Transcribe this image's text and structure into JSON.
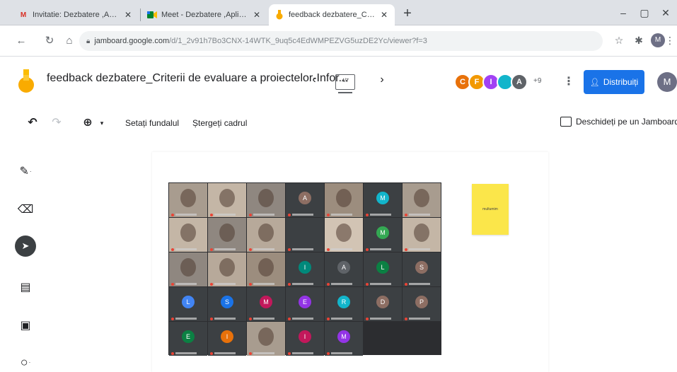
{
  "browser": {
    "tabs": [
      {
        "label": "Invitatie: Dezbatere ,Aplicarea c",
        "favicon": "M",
        "favicon_color": "#d93025",
        "active": false
      },
      {
        "label": "Meet - Dezbatere ,Aplicarea cri",
        "favicon": "meet-icon",
        "favicon_color": "#00832d",
        "active": false
      },
      {
        "label": "feedback dezbatere_Criterii de",
        "favicon": "jamboard-icon",
        "favicon_color": "#f9ab00",
        "active": true
      }
    ],
    "new_tab": "+",
    "url_host": "jamboard.google.com",
    "url_path": "/d/1_2v91h7Bo3CNX-14WTK_9uq5c4EdWMPEZVG5uzDE2Yc/viewer?f=3",
    "window_controls": [
      "–",
      "▢",
      "✕"
    ]
  },
  "board": {
    "title": "feedback dezbatere_Criterii de evaluare a proiectelor-Infor...",
    "frame_indicator": "4/7",
    "prev": "‹",
    "next": "›",
    "collaborators": [
      {
        "initial": "C",
        "color": "#e8710a"
      },
      {
        "initial": "F",
        "color": "#f29900"
      },
      {
        "initial": "I",
        "color": "#a142f4"
      },
      {
        "initial": "",
        "color": "#12b5cb"
      },
      {
        "initial": "A",
        "color": "#5f6368"
      }
    ],
    "collaborators_more": "+9",
    "share_label": "Distribuiți",
    "profile_initial": "M"
  },
  "toolbar": {
    "undo": "↶",
    "redo": "↷",
    "zoom": "⊕",
    "zoom_caret": "▾",
    "set_background": "Setați fundalul",
    "clear_frame": "Ștergeți cadrul",
    "open_in_jamboard": "Deschideți pe un Jamboard"
  },
  "tools": [
    {
      "name": "pen-tool",
      "glyph": "✎",
      "has_menu": true,
      "selected": false
    },
    {
      "name": "eraser-tool",
      "glyph": "⌫",
      "has_menu": false,
      "selected": false
    },
    {
      "name": "select-tool",
      "glyph": "➤",
      "has_menu": false,
      "selected": true
    },
    {
      "name": "sticky-note-tool",
      "glyph": "▤",
      "has_menu": false,
      "selected": false
    },
    {
      "name": "image-tool",
      "glyph": "▣",
      "has_menu": false,
      "selected": false
    },
    {
      "name": "shape-tool",
      "glyph": "○",
      "has_menu": true,
      "selected": false
    }
  ],
  "meet_tiles": [
    {
      "initial": "",
      "color": "",
      "photo": true
    },
    {
      "initial": "",
      "color": "",
      "photo": true
    },
    {
      "initial": "",
      "color": "",
      "photo": true
    },
    {
      "initial": "A",
      "color": "#8d6e63",
      "photo": false
    },
    {
      "initial": "",
      "color": "",
      "photo": true
    },
    {
      "initial": "M",
      "color": "#12b5cb",
      "photo": false
    },
    {
      "initial": "",
      "color": "",
      "photo": true
    },
    {
      "initial": "",
      "color": "",
      "photo": true
    },
    {
      "initial": "",
      "color": "",
      "photo": true
    },
    {
      "initial": "",
      "color": "",
      "photo": true
    },
    {
      "initial": "",
      "color": "",
      "photo": false
    },
    {
      "initial": "",
      "color": "",
      "photo": true
    },
    {
      "initial": "M",
      "color": "#34a853",
      "photo": false
    },
    {
      "initial": "",
      "color": "",
      "photo": true
    },
    {
      "initial": "",
      "color": "",
      "photo": true
    },
    {
      "initial": "",
      "color": "",
      "photo": true
    },
    {
      "initial": "",
      "color": "",
      "photo": true
    },
    {
      "initial": "I",
      "color": "#00897b",
      "photo": false
    },
    {
      "initial": "A",
      "color": "#5f6368",
      "photo": false
    },
    {
      "initial": "L",
      "color": "#0b8043",
      "photo": false
    },
    {
      "initial": "S",
      "color": "#8d6e63",
      "photo": false
    },
    {
      "initial": "L",
      "color": "#4285f4",
      "photo": false
    },
    {
      "initial": "S",
      "color": "#1a73e8",
      "photo": false
    },
    {
      "initial": "M",
      "color": "#c2185b",
      "photo": false
    },
    {
      "initial": "E",
      "color": "#9334e6",
      "photo": false
    },
    {
      "initial": "R",
      "color": "#12b5cb",
      "photo": false
    },
    {
      "initial": "D",
      "color": "#8d6e63",
      "photo": false
    },
    {
      "initial": "P",
      "color": "#8d6e63",
      "photo": false
    },
    {
      "initial": "E",
      "color": "#0b8043",
      "photo": false
    },
    {
      "initial": "I",
      "color": "#e8710a",
      "photo": false
    },
    {
      "initial": "",
      "color": "",
      "photo": true
    },
    {
      "initial": "I",
      "color": "#c2185b",
      "photo": false
    },
    {
      "initial": "M",
      "color": "#9334e6",
      "photo": false
    }
  ],
  "sticky_note": {
    "text": "multumim",
    "color": "#fbe64a"
  }
}
